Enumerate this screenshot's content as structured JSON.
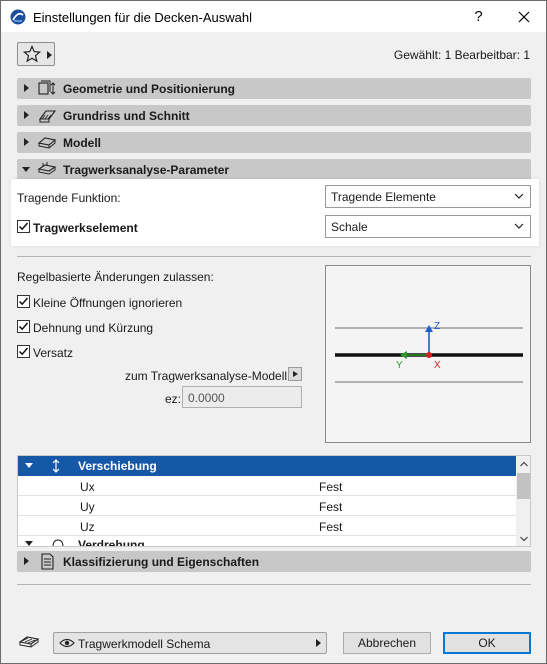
{
  "window": {
    "title": "Einstellungen für die Decken-Auswahl",
    "help_label": "?",
    "close_label": "✕"
  },
  "toolbar": {
    "selection_info": "Gewählt: 1 Bearbeitbar: 1"
  },
  "panels": [
    {
      "label": "Geometrie und Positionierung",
      "icon": "geometry-icon",
      "expanded": false
    },
    {
      "label": "Grundriss und Schnitt",
      "icon": "floorplan-section-icon",
      "expanded": false
    },
    {
      "label": "Modell",
      "icon": "model-icon",
      "expanded": false
    },
    {
      "label": "Tragwerksanalyse-Parameter",
      "icon": "structural-analysis-icon",
      "expanded": true
    }
  ],
  "structural": {
    "function_label": "Tragende Funktion:",
    "function_value": "Tragende Elemente",
    "element_label": "Tragwerkselement",
    "element_checked": true,
    "element_value": "Schale",
    "rules_label": "Regelbasierte Änderungen zulassen:",
    "options": [
      {
        "label": "Kleine Öffnungen ignorieren",
        "checked": true
      },
      {
        "label": "Dehnung und Kürzung",
        "checked": true
      },
      {
        "label": "Versatz",
        "checked": true
      }
    ],
    "model_link_label": "zum Tragwerksanalyse-Modell",
    "ez_label": "ez:",
    "ez_value": "0.0000"
  },
  "preview": {
    "axis_z": "Z",
    "axis_y": "Y",
    "axis_x": "X",
    "colors": {
      "z": "#1f5fc8",
      "y": "#2e9a2e",
      "x": "#d42020"
    }
  },
  "tree": {
    "header_label": "Verschiebung",
    "rows": [
      {
        "name": "Ux",
        "value": "Fest"
      },
      {
        "name": "Uy",
        "value": "Fest"
      },
      {
        "name": "Uz",
        "value": "Fest"
      }
    ],
    "cut_label": "Verdrehung"
  },
  "classification": {
    "label": "Klassifizierung und Eigenschaften",
    "icon": "document-icon"
  },
  "footer": {
    "schema_label": "Tragwerkmodell Schema",
    "cancel_label": "Abbrechen",
    "ok_label": "OK"
  },
  "colors": {
    "accent": "#1658a8",
    "panel_bg": "#c8c8c8",
    "dialog_bg": "#f0f0f0"
  }
}
